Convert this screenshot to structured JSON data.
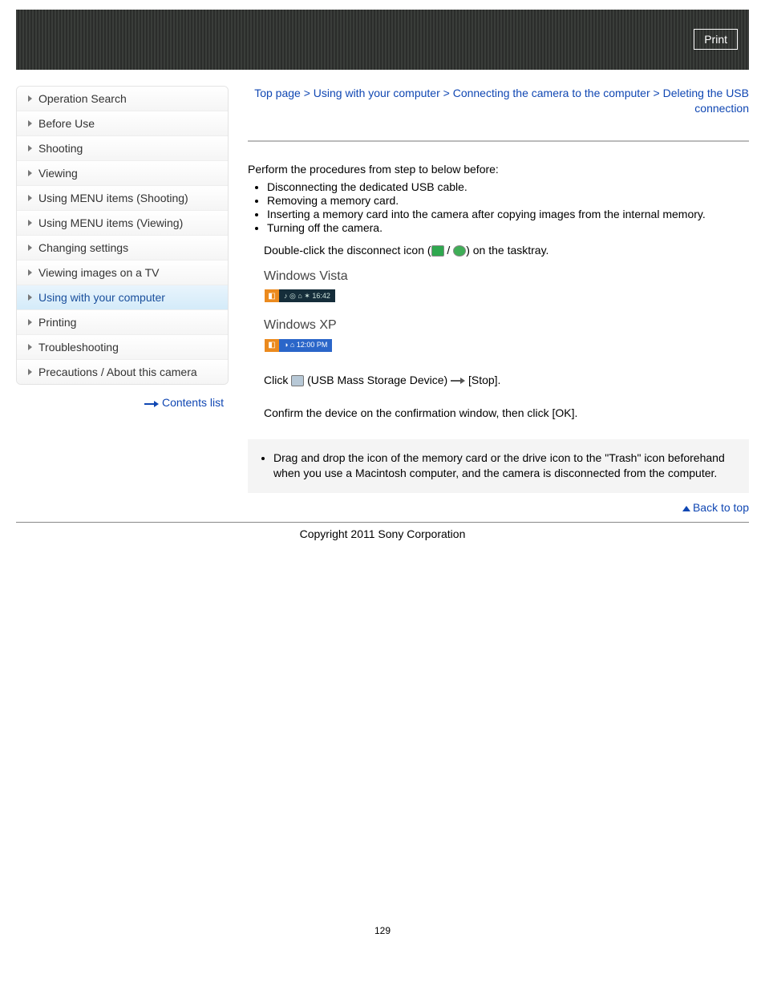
{
  "header": {
    "print_label": "Print"
  },
  "sidebar": {
    "items": [
      {
        "label": "Operation Search"
      },
      {
        "label": "Before Use"
      },
      {
        "label": "Shooting"
      },
      {
        "label": "Viewing"
      },
      {
        "label": "Using MENU items (Shooting)"
      },
      {
        "label": "Using MENU items (Viewing)"
      },
      {
        "label": "Changing settings"
      },
      {
        "label": "Viewing images on a TV"
      },
      {
        "label": "Using with your computer"
      },
      {
        "label": "Printing"
      },
      {
        "label": "Troubleshooting"
      },
      {
        "label": "Precautions / About this camera"
      }
    ],
    "contents_list": "Contents list"
  },
  "breadcrumb": {
    "top": "Top page",
    "sep": " > ",
    "l1": "Using with your computer",
    "l2": "Connecting the camera to the computer",
    "l3": "Deleting the USB connection"
  },
  "content": {
    "intro": "Perform the procedures from step     to     below before:",
    "bullets": [
      "Disconnecting the dedicated USB cable.",
      "Removing a memory card.",
      "Inserting a memory card into the camera after copying images from the internal memory.",
      "Turning off the camera."
    ],
    "step1_a": "Double-click the disconnect icon (",
    "step1_b": ") on the tasktray.",
    "os_vista": "Windows Vista",
    "os_xp": "Windows XP",
    "step2_a": "Click ",
    "step2_b": " (USB Mass Storage Device) ",
    "step2_c": " [Stop].",
    "step3": "Confirm the device on the confirmation window, then click [OK].",
    "note": "Drag and drop the icon of the memory card or the drive icon to the \"Trash\" icon beforehand when you use a Macintosh computer, and the camera is disconnected from the computer.",
    "back_top": "Back to top"
  },
  "footer": {
    "copyright": "Copyright 2011 Sony Corporation"
  },
  "page_number": "129"
}
